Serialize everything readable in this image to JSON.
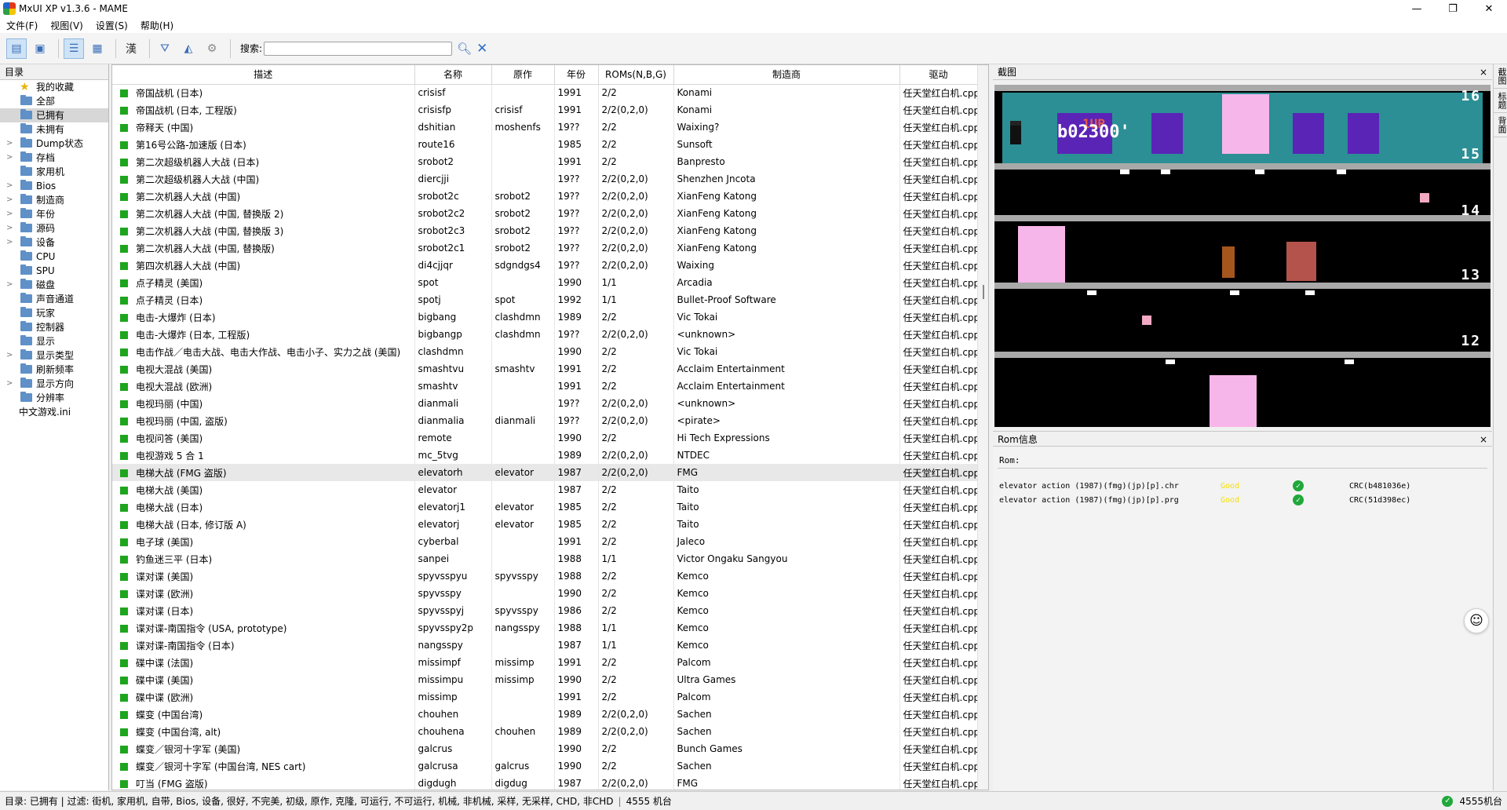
{
  "window": {
    "title": "MxUI XP v1.3.6 - MAME",
    "minimize": "—",
    "maximize": "❐",
    "close": "✕"
  },
  "menu": [
    "文件(F)",
    "视图(V)",
    "设置(S)",
    "帮助(H)"
  ],
  "toolbar": {
    "search_label": "搜索:",
    "search_value": "",
    "han_label": "漢"
  },
  "tree": {
    "header": "目录",
    "items": [
      {
        "label": "我的收藏",
        "icon": "star",
        "exp": "",
        "selected": false
      },
      {
        "label": "全部",
        "icon": "folder",
        "exp": "",
        "selected": false
      },
      {
        "label": "已拥有",
        "icon": "folder",
        "exp": "",
        "selected": true
      },
      {
        "label": "未拥有",
        "icon": "folder",
        "exp": "",
        "selected": false
      },
      {
        "label": "Dump状态",
        "icon": "folder",
        "exp": ">",
        "selected": false
      },
      {
        "label": "存档",
        "icon": "folder",
        "exp": ">",
        "selected": false
      },
      {
        "label": "家用机",
        "icon": "folder",
        "exp": "",
        "selected": false
      },
      {
        "label": "Bios",
        "icon": "folder",
        "exp": ">",
        "selected": false
      },
      {
        "label": "制造商",
        "icon": "folder",
        "exp": ">",
        "selected": false
      },
      {
        "label": "年份",
        "icon": "folder",
        "exp": ">",
        "selected": false
      },
      {
        "label": "源码",
        "icon": "folder",
        "exp": ">",
        "selected": false
      },
      {
        "label": "设备",
        "icon": "folder",
        "exp": ">",
        "selected": false
      },
      {
        "label": "CPU",
        "icon": "folder",
        "exp": "",
        "selected": false
      },
      {
        "label": "SPU",
        "icon": "folder",
        "exp": "",
        "selected": false
      },
      {
        "label": "磁盘",
        "icon": "folder",
        "exp": ">",
        "selected": false
      },
      {
        "label": "声音通道",
        "icon": "folder",
        "exp": "",
        "selected": false
      },
      {
        "label": "玩家",
        "icon": "folder",
        "exp": "",
        "selected": false
      },
      {
        "label": "控制器",
        "icon": "folder",
        "exp": "",
        "selected": false
      },
      {
        "label": "显示",
        "icon": "folder",
        "exp": "",
        "selected": false
      },
      {
        "label": "显示类型",
        "icon": "folder",
        "exp": ">",
        "selected": false
      },
      {
        "label": "刷新频率",
        "icon": "folder",
        "exp": "",
        "selected": false
      },
      {
        "label": "显示方向",
        "icon": "folder",
        "exp": ">",
        "selected": false
      },
      {
        "label": "分辨率",
        "icon": "folder",
        "exp": "",
        "selected": false
      },
      {
        "label": "中文游戏.ini",
        "icon": "none",
        "exp": "",
        "selected": false
      }
    ]
  },
  "columns": [
    "描述",
    "名称",
    "原作",
    "年份",
    "ROMs(N,B,G)",
    "制造商",
    "驱动"
  ],
  "rows": [
    [
      "帝国战机 (日本)",
      "crisisf",
      "",
      "1991",
      "2/2",
      "Konami",
      "任天堂红白机.cpp"
    ],
    [
      "帝国战机 (日本, 工程版)",
      "crisisfp",
      "crisisf",
      "1991",
      "2/2(0,2,0)",
      "Konami",
      "任天堂红白机.cpp"
    ],
    [
      "帝释天 (中国)",
      "dshitian",
      "moshenfs",
      "19??",
      "2/2",
      "Waixing?",
      "任天堂红白机.cpp"
    ],
    [
      "第16号公路-加速版 (日本)",
      "route16",
      "",
      "1985",
      "2/2",
      "Sunsoft",
      "任天堂红白机.cpp"
    ],
    [
      "第二次超级机器人大战 (日本)",
      "srobot2",
      "",
      "1991",
      "2/2",
      "Banpresto",
      "任天堂红白机.cpp"
    ],
    [
      "第二次超级机器人大战 (中国)",
      "diercjji",
      "",
      "19??",
      "2/2(0,2,0)",
      "Shenzhen Jncota",
      "任天堂红白机.cpp"
    ],
    [
      "第二次机器人大战 (中国)",
      "srobot2c",
      "srobot2",
      "19??",
      "2/2(0,2,0)",
      "XianFeng Katong",
      "任天堂红白机.cpp"
    ],
    [
      "第二次机器人大战 (中国, 替换版 2)",
      "srobot2c2",
      "srobot2",
      "19??",
      "2/2(0,2,0)",
      "XianFeng Katong",
      "任天堂红白机.cpp"
    ],
    [
      "第二次机器人大战 (中国, 替换版 3)",
      "srobot2c3",
      "srobot2",
      "19??",
      "2/2(0,2,0)",
      "XianFeng Katong",
      "任天堂红白机.cpp"
    ],
    [
      "第二次机器人大战 (中国, 替换版)",
      "srobot2c1",
      "srobot2",
      "19??",
      "2/2(0,2,0)",
      "XianFeng Katong",
      "任天堂红白机.cpp"
    ],
    [
      "第四次机器人大战 (中国)",
      "di4cjjqr",
      "sdgndgs4",
      "19??",
      "2/2(0,2,0)",
      "Waixing",
      "任天堂红白机.cpp"
    ],
    [
      "点子精灵 (美国)",
      "spot",
      "",
      "1990",
      "1/1",
      "Arcadia",
      "任天堂红白机.cpp"
    ],
    [
      "点子精灵 (日本)",
      "spotj",
      "spot",
      "1992",
      "1/1",
      "Bullet-Proof Software",
      "任天堂红白机.cpp"
    ],
    [
      "电击-大爆炸 (日本)",
      "bigbang",
      "clashdmn",
      "1989",
      "2/2",
      "Vic Tokai",
      "任天堂红白机.cpp"
    ],
    [
      "电击-大爆炸 (日本, 工程版)",
      "bigbangp",
      "clashdmn",
      "19??",
      "2/2(0,2,0)",
      "<unknown>",
      "任天堂红白机.cpp"
    ],
    [
      "电击作战／电击大战、电击大作战、电击小子、实力之战 (美国)",
      "clashdmn",
      "",
      "1990",
      "2/2",
      "Vic Tokai",
      "任天堂红白机.cpp"
    ],
    [
      "电视大混战 (美国)",
      "smashtvu",
      "smashtv",
      "1991",
      "2/2",
      "Acclaim Entertainment",
      "任天堂红白机.cpp"
    ],
    [
      "电视大混战 (欧洲)",
      "smashtv",
      "",
      "1991",
      "2/2",
      "Acclaim Entertainment",
      "任天堂红白机.cpp"
    ],
    [
      "电视玛丽 (中国)",
      "dianmali",
      "",
      "19??",
      "2/2(0,2,0)",
      "<unknown>",
      "任天堂红白机.cpp"
    ],
    [
      "电视玛丽 (中国, 盗版)",
      "dianmalia",
      "dianmali",
      "19??",
      "2/2(0,2,0)",
      "<pirate>",
      "任天堂红白机.cpp"
    ],
    [
      "电视问答 (美国)",
      "remote",
      "",
      "1990",
      "2/2",
      "Hi Tech Expressions",
      "任天堂红白机.cpp"
    ],
    [
      "电视游戏 5 合 1",
      "mc_5tvg",
      "",
      "1989",
      "2/2(0,2,0)",
      "NTDEC",
      "任天堂红白机.cpp"
    ],
    [
      "电梯大战 (FMG 盗版)",
      "elevatorh",
      "elevator",
      "1987",
      "2/2(0,2,0)",
      "FMG",
      "任天堂红白机.cpp"
    ],
    [
      "电梯大战 (美国)",
      "elevator",
      "",
      "1987",
      "2/2",
      "Taito",
      "任天堂红白机.cpp"
    ],
    [
      "电梯大战 (日本)",
      "elevatorj1",
      "elevator",
      "1985",
      "2/2",
      "Taito",
      "任天堂红白机.cpp"
    ],
    [
      "电梯大战 (日本, 修订版 A)",
      "elevatorj",
      "elevator",
      "1985",
      "2/2",
      "Taito",
      "任天堂红白机.cpp"
    ],
    [
      "电子球 (美国)",
      "cyberbal",
      "",
      "1991",
      "2/2",
      "Jaleco",
      "任天堂红白机.cpp"
    ],
    [
      "钓鱼迷三平 (日本)",
      "sanpei",
      "",
      "1988",
      "1/1",
      "Victor Ongaku Sangyou",
      "任天堂红白机.cpp"
    ],
    [
      "谍对谍 (美国)",
      "spyvsspyu",
      "spyvsspy",
      "1988",
      "2/2",
      "Kemco",
      "任天堂红白机.cpp"
    ],
    [
      "谍对谍 (欧洲)",
      "spyvsspy",
      "",
      "1990",
      "2/2",
      "Kemco",
      "任天堂红白机.cpp"
    ],
    [
      "谍对谍 (日本)",
      "spyvsspyj",
      "spyvsspy",
      "1986",
      "2/2",
      "Kemco",
      "任天堂红白机.cpp"
    ],
    [
      "谍对谍-南国指令 (USA, prototype)",
      "spyvsspy2p",
      "nangsspy",
      "1988",
      "1/1",
      "Kemco",
      "任天堂红白机.cpp"
    ],
    [
      "谍对谍-南国指令 (日本)",
      "nangsspy",
      "",
      "1987",
      "1/1",
      "Kemco",
      "任天堂红白机.cpp"
    ],
    [
      "碟中谍 (法国)",
      "missimpf",
      "missimp",
      "1991",
      "2/2",
      "Palcom",
      "任天堂红白机.cpp"
    ],
    [
      "碟中谍 (美国)",
      "missimpu",
      "missimp",
      "1990",
      "2/2",
      "Ultra Games",
      "任天堂红白机.cpp"
    ],
    [
      "碟中谍 (欧洲)",
      "missimp",
      "",
      "1991",
      "2/2",
      "Palcom",
      "任天堂红白机.cpp"
    ],
    [
      "蝶变 (中国台湾)",
      "chouhen",
      "",
      "1989",
      "2/2(0,2,0)",
      "Sachen",
      "任天堂红白机.cpp"
    ],
    [
      "蝶变 (中国台湾, alt)",
      "chouhena",
      "chouhen",
      "1989",
      "2/2(0,2,0)",
      "Sachen",
      "任天堂红白机.cpp"
    ],
    [
      "蝶变／银河十字军 (美国)",
      "galcrus",
      "",
      "1990",
      "2/2",
      "Bunch Games",
      "任天堂红白机.cpp"
    ],
    [
      "蝶变／银河十字军 (中国台湾, NES cart)",
      "galcrusa",
      "galcrus",
      "1990",
      "2/2",
      "Sachen",
      "任天堂红白机.cpp"
    ],
    [
      "叮当 (FMG 盗版)",
      "digdugh",
      "digdug",
      "1987",
      "2/2(0,2,0)",
      "FMG",
      "任天堂红白机.cpp"
    ]
  ],
  "selected_row_index": 22,
  "screenshot_panel": {
    "title": "截图",
    "close": "×",
    "hud_1up": "1UP",
    "hud_score": "b02300'",
    "floors": [
      "16",
      "15",
      "14",
      "13",
      "12"
    ]
  },
  "rom_panel": {
    "title": "Rom信息",
    "close": "×",
    "heading": "Rom:",
    "files": [
      {
        "name": "elevator action (1987)(fmg)(jp)[p].chr",
        "status": "Good",
        "crc": "CRC(b481036e)"
      },
      {
        "name": "elevator action (1987)(fmg)(jp)[p].prg",
        "status": "Good",
        "crc": "CRC(51d398ec)"
      }
    ]
  },
  "side_tabs": [
    "截图",
    "标题",
    "背面"
  ],
  "status": {
    "text": "目录: 已拥有  |  过滤: 街机, 家用机, 自带, Bios, 设备, 很好, 不完美, 初级, 原作, 克隆, 可运行, 不可运行, 机械, 非机械, 采样, 无采样, CHD, 非CHD",
    "count": "4555 机台",
    "count_right": "4555机台"
  },
  "colors": {
    "status_green": "#1ea51e",
    "teal": "#2b8f95",
    "purple_door": "#5a24b7",
    "pink_shaft": "#f7b6ea"
  }
}
